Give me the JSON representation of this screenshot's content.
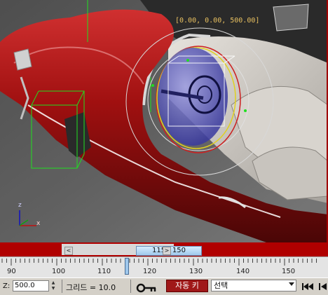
{
  "viewport": {
    "coord_readout": "[0.00, 0.00, 500.00]",
    "axis_z": "z",
    "axis_x": "x"
  },
  "timeline": {
    "frame_display": "115 / 150",
    "left_arrow": "<",
    "right_arrow": ">",
    "current_frame": 115,
    "total_frames": 150,
    "ruler_labels": [
      "90",
      "100",
      "110",
      "120",
      "130",
      "140",
      "150"
    ]
  },
  "statusbar": {
    "z_label": "Z:",
    "z_value": "500.0",
    "grid_label": "그리드 = 10.0",
    "autokey_label": "자동 키",
    "selection_value": "선택"
  },
  "colors": {
    "timebar": "#b00000",
    "autokey": "#a01818",
    "slider": "#9fc8ec"
  }
}
